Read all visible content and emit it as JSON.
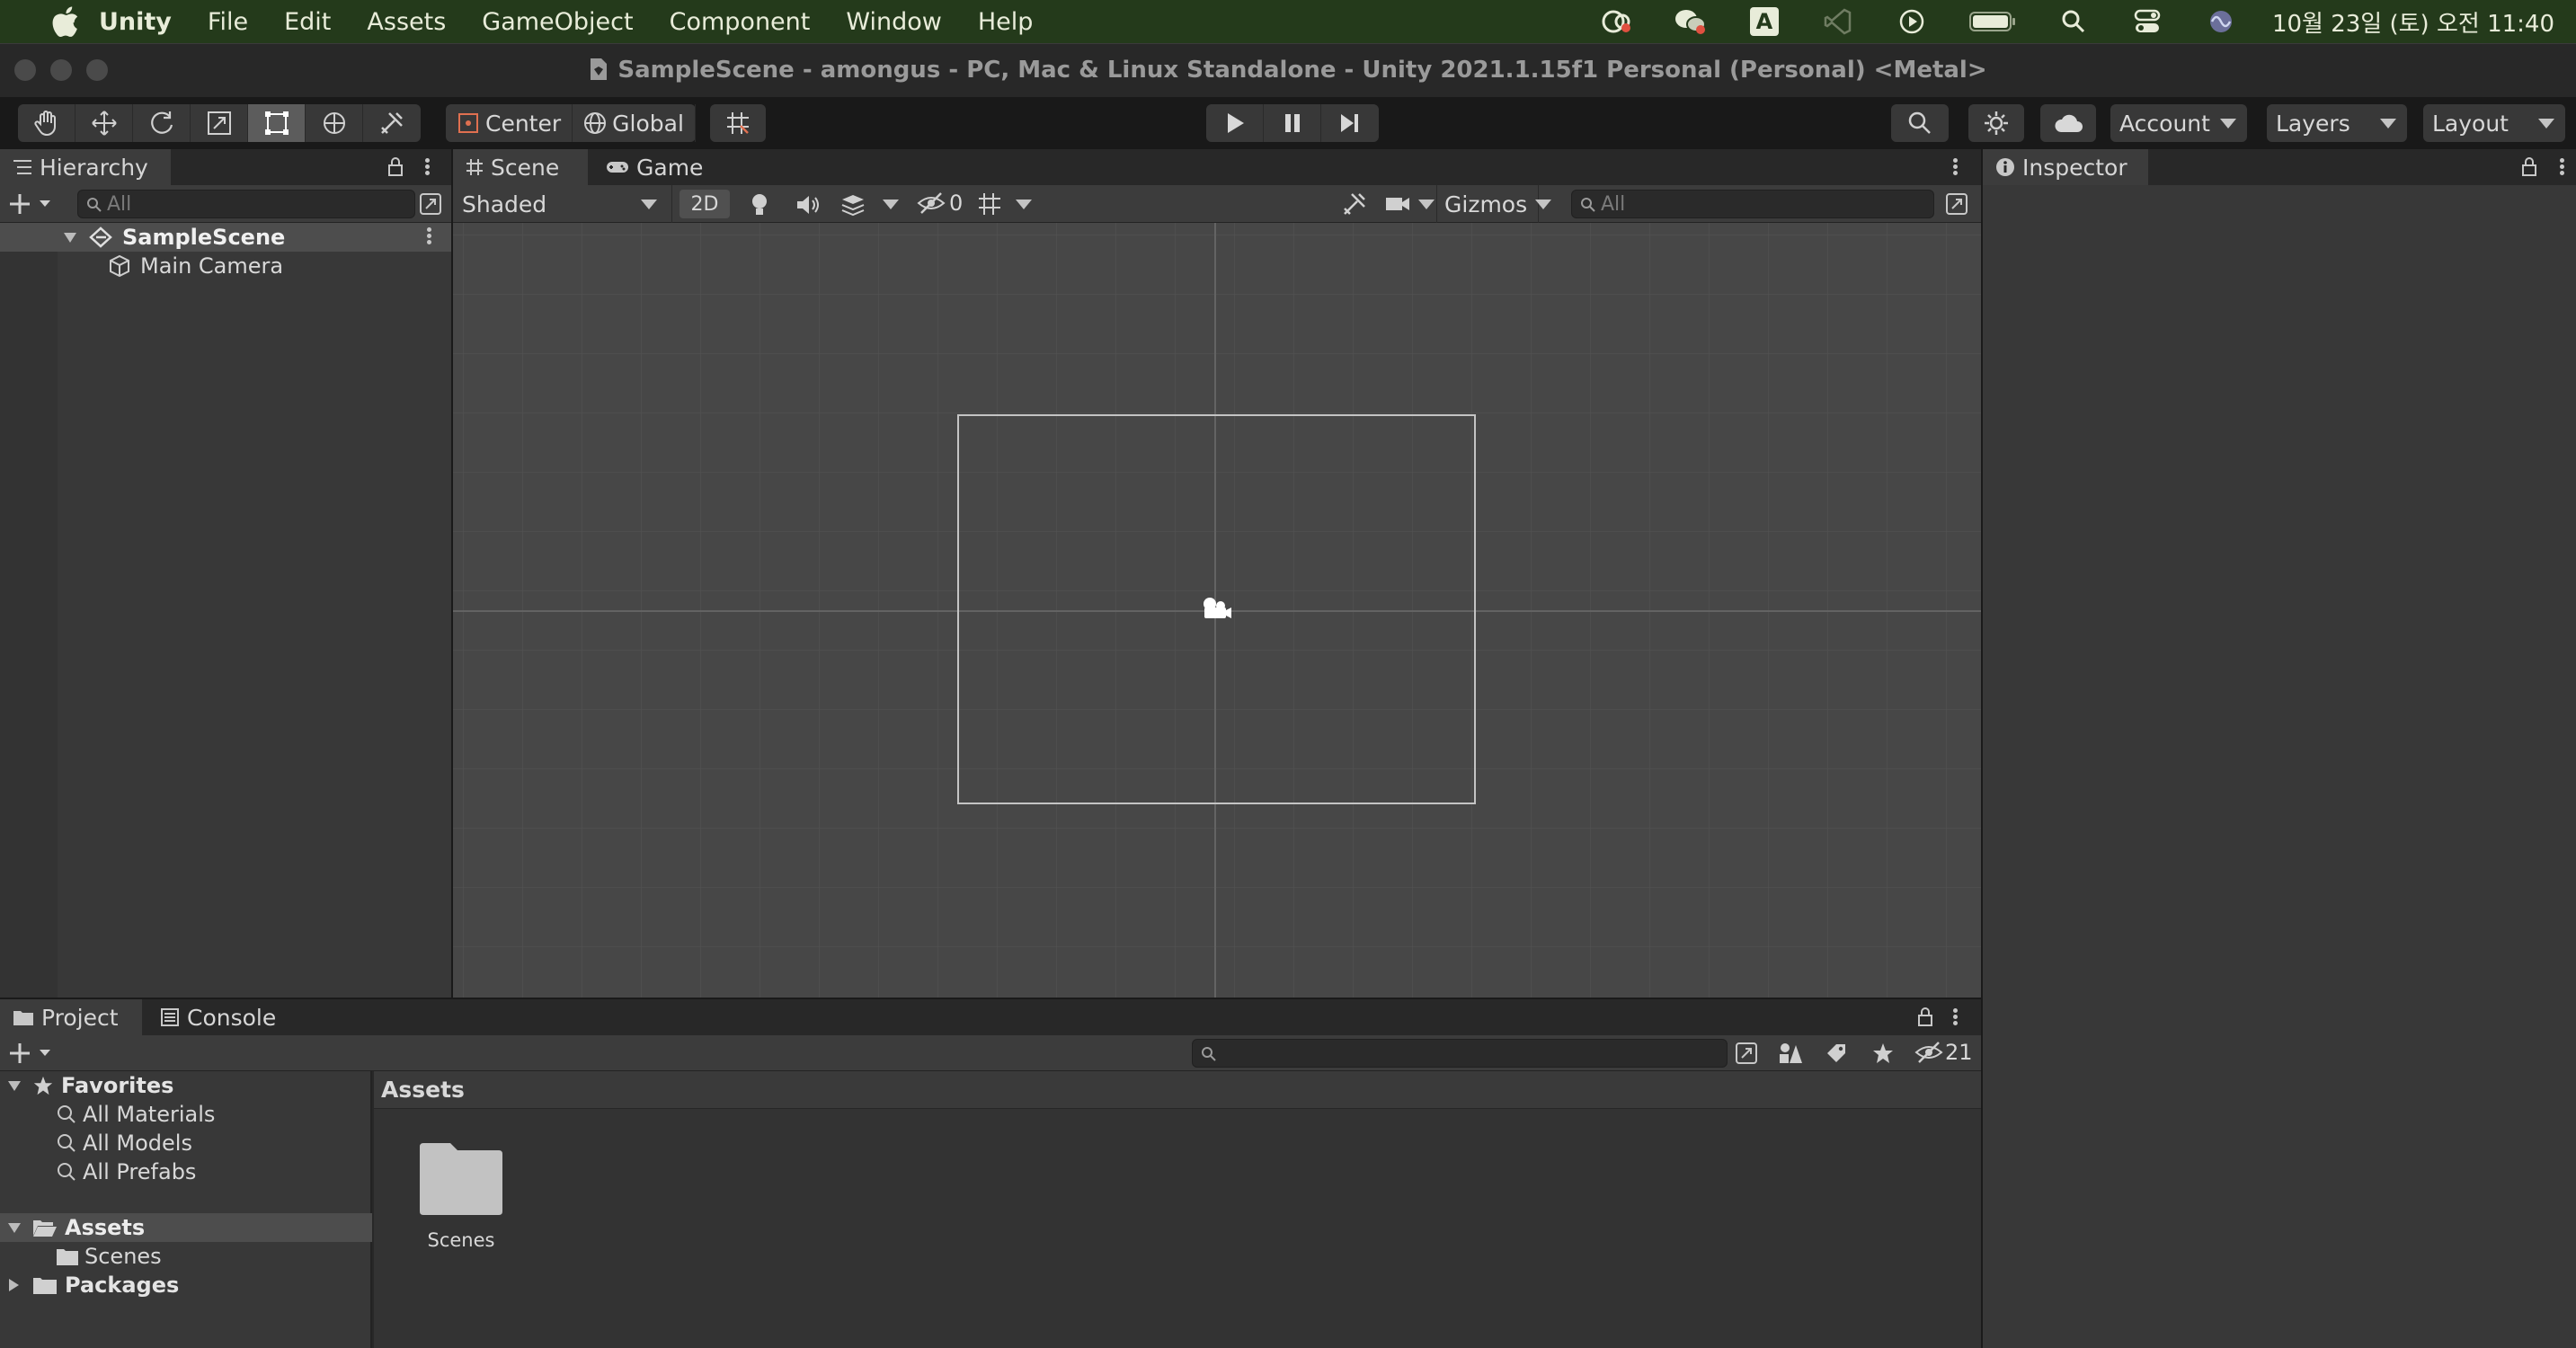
{
  "menubar": {
    "app": "Unity",
    "items": [
      "File",
      "Edit",
      "Assets",
      "GameObject",
      "Component",
      "Window",
      "Help"
    ],
    "clock": "10월 23일 (토) 오전 11:40",
    "status_icons": [
      "creative-cloud-icon",
      "wechat-icon",
      "input-source-icon",
      "vscode-icon",
      "play-circle-icon",
      "battery-icon",
      "spotlight-search-icon",
      "control-center-icon",
      "siri-icon"
    ],
    "input_source_letter": "A"
  },
  "window": {
    "title": "SampleScene - amongus - PC, Mac & Linux Standalone - Unity 2021.1.15f1 Personal (Personal) <Metal>"
  },
  "toolbar": {
    "tools": [
      "hand-tool-icon",
      "move-tool-icon",
      "rotate-tool-icon",
      "scale-tool-icon",
      "rect-tool-icon",
      "transform-tool-icon",
      "custom-tool-icon"
    ],
    "selected_tool": "rect-tool-icon",
    "pivot_label": "Center",
    "space_label": "Global",
    "account_label": "Account",
    "layers_label": "Layers",
    "layout_label": "Layout"
  },
  "hierarchy": {
    "tab_label": "Hierarchy",
    "search_placeholder": "All",
    "scene_name": "SampleScene",
    "objects": [
      "Main Camera"
    ]
  },
  "scene_view": {
    "tabs": [
      "Scene",
      "Game"
    ],
    "draw_mode": "Shaded",
    "mode_2d": "2D",
    "hidden_count": "0",
    "gizmos_label": "Gizmos",
    "search_placeholder": "All"
  },
  "inspector": {
    "tab_label": "Inspector"
  },
  "project": {
    "tabs": [
      "Project",
      "Console"
    ],
    "favorites_label": "Favorites",
    "favorites": [
      "All Materials",
      "All Models",
      "All Prefabs"
    ],
    "tree": {
      "assets_label": "Assets",
      "assets_children": [
        "Scenes"
      ],
      "packages_label": "Packages"
    },
    "breadcrumb": "Assets",
    "items": [
      {
        "name": "Scenes",
        "icon": "folder-icon"
      }
    ],
    "hidden_count": "21"
  },
  "colors": {
    "menubar": "#243a1b",
    "panel": "#383838",
    "scene_bg": "#474747",
    "toolbar": "#191919"
  }
}
